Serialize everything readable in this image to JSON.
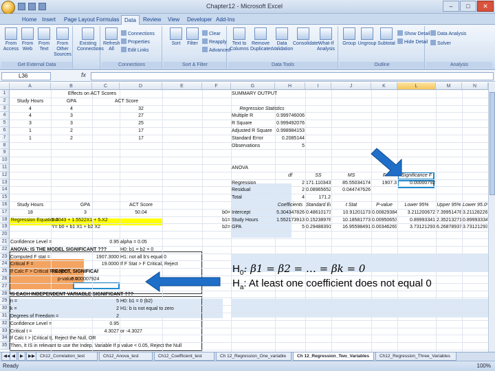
{
  "window": {
    "title": "Chapter12 - Microsoft Excel"
  },
  "tabs": [
    "Home",
    "Insert",
    "Page Layout",
    "Formulas",
    "Data",
    "Review",
    "View",
    "Developer",
    "Add-Ins"
  ],
  "active_tab": "Data",
  "ribbon": {
    "groups": [
      {
        "label": "Get External Data",
        "buttons": [
          "From Access",
          "From Web",
          "From Text",
          "From Other Sources"
        ]
      },
      {
        "label": "",
        "buttons": [
          "Existing Connections"
        ]
      },
      {
        "label": "Connections",
        "buttons": [
          "Refresh All"
        ],
        "small": [
          "Connections",
          "Properties",
          "Edit Links"
        ]
      },
      {
        "label": "Sort & Filter",
        "buttons": [
          "Sort",
          "Filter"
        ],
        "small": [
          "Clear",
          "Reapply",
          "Advanced"
        ]
      },
      {
        "label": "Data Tools",
        "buttons": [
          "Text to Columns",
          "Remove Duplicates",
          "Data Validation",
          "Consolidate",
          "What-If Analysis"
        ]
      },
      {
        "label": "Outline",
        "buttons": [
          "Group",
          "Ungroup",
          "Subtotal"
        ],
        "small": [
          "Show Detail",
          "Hide Detail"
        ]
      },
      {
        "label": "Analysis",
        "small": [
          "Data Analysis",
          "Solver"
        ]
      }
    ]
  },
  "formula_bar": {
    "name_box": "L36",
    "fx": "fx",
    "value": ""
  },
  "columns": [
    "A",
    "B",
    "C",
    "D",
    "E",
    "F",
    "G",
    "H",
    "I",
    "J",
    "K",
    "L",
    "M",
    "N"
  ],
  "rows": [
    "1",
    "2",
    "3",
    "4",
    "5",
    "6",
    "7",
    "8",
    "9",
    "10",
    "11",
    "12",
    "13",
    "14",
    "15",
    "16",
    "17",
    "18",
    "19",
    "20",
    "21",
    "22",
    "23",
    "24",
    "25",
    "26",
    "27",
    "28",
    "29",
    "30",
    "31",
    "32",
    "33",
    "34",
    "35"
  ],
  "left_table": {
    "title": "Effects on ACT Scores",
    "headers": [
      "Study Hours",
      "GPA",
      "ACT Score"
    ],
    "data": [
      [
        "4",
        "4",
        "32"
      ],
      [
        "4",
        "3",
        "27"
      ],
      [
        "3",
        "3",
        "25"
      ],
      [
        "1",
        "2",
        "17"
      ],
      [
        "1",
        "2",
        "17"
      ]
    ]
  },
  "prediction": {
    "headers": [
      "Study Hours",
      "GPA",
      "ACT Score"
    ],
    "values": [
      "18",
      "3",
      "50.04"
    ],
    "equation_label": "Regression Equation=",
    "equation": "5.3043 + 1.5522X1 + 5.X2",
    "general_form": "Y= b0 + b1 X1 + b2 X2"
  },
  "tests": {
    "confidence_label": "Confidence Level =",
    "confidence_value": "0.95",
    "alpha": "alpha = 0.05",
    "model_q": "ANOVA: IS THE MODEL SIGNIFICANT ???",
    "h0": "H0: b1 = b2 = 0",
    "h1": "H1: not all b's equal 0",
    "computed_f_label": "Computed F stat =",
    "computed_f": "1907.3000",
    "critical_f_label": "Critical F =",
    "critical_f": "19.0000",
    "rule1": "If F Stat > F Critical, Reject",
    "decision_label": "If Calc F > Critical F, Reject",
    "decision": "REJECT, SIGNIFICANT",
    "pvalue_label": "p-value =",
    "pvalue": "0.000007924",
    "var_q": "IS EACH INDEPENDENT VARIABLE SIGNIFICANT ???",
    "h0b": "H0: b1 = 0 (b2)",
    "h1b": "H1: b is not equal to zero",
    "n_label": "n =",
    "n": "5",
    "k_label": "k =",
    "k": "2",
    "df_label": "Degrees of Freedom =",
    "df": "2",
    "conf2_label": "Confidence Level =",
    "conf2": "0.95",
    "critical_t_label": "Critical t =",
    "critical_t": "4.3027",
    "critical_t2": "or -4.3027",
    "rule2": "If Calc t > |Critical t|, Reject the Null, OR",
    "rule3": "Then, It IS in relevant to use the Indep. Variable   If p value < 0.05, Reject the Null"
  },
  "summary": {
    "title": "SUMMARY OUTPUT",
    "reg_title": "Regression Statistics",
    "stats": [
      [
        "Multiple R",
        "0.999746006"
      ],
      [
        "R Square",
        "0.999492076"
      ],
      [
        "Adjusted R Square",
        "0.998984153"
      ],
      [
        "Standard Error",
        "0.2085144"
      ],
      [
        "Observations",
        "5"
      ]
    ],
    "anova_title": "ANOVA",
    "anova_headers": [
      "",
      "df",
      "SS",
      "MS",
      "F",
      "Significance F"
    ],
    "anova_rows": [
      [
        "Regression",
        "2",
        "171.1103435",
        "85.55034174",
        "1907.3",
        "0.00000792"
      ],
      [
        "Residual",
        "2",
        "0.089656522",
        "0.044747626",
        "",
        ""
      ],
      [
        "Total",
        "4",
        "171.2",
        "",
        "",
        ""
      ]
    ],
    "coef_headers": [
      "",
      "Coefficients",
      "Standard Error",
      "t Stat",
      "P-value",
      "Lower 95%",
      "Upper 95%",
      "Lower 95.0%"
    ],
    "coef_rows": [
      [
        "b0=",
        "Intercept",
        "5.304347826",
        "0.486101734",
        "10.91201173",
        "0.00829384",
        "3.211200672",
        "7.39951478",
        "3.211282267"
      ],
      [
        "b1=",
        "Study Hours",
        "1.552173913",
        "0.152389788",
        "10.18581773",
        "0.00950653",
        "0.89993341",
        "2.352132712",
        "0.899933341"
      ],
      [
        "b2=",
        "GPA",
        "5",
        "0.294883912",
        "16.95598491",
        "0.00346269",
        "3.73121293",
        "6.26878937",
        "3.73121293"
      ]
    ]
  },
  "overlay": {
    "line1_prefix": "H",
    "line1_sub": "0",
    "line1_rest": ": β1 = β2 = … = βk = 0",
    "line2_prefix": "H",
    "line2_sub": "a",
    "line2_rest": ": At least one coefficient does not equal 0"
  },
  "sheet_tabs": [
    "Ch12_Correlation_test",
    "Ch12_Anova_test",
    "Ch12_Coefficient_test",
    "Ch 12_Regression_One_variable",
    "Ch 12_Regression_Two_Variables",
    "Ch12_Regression_Three_Variables"
  ],
  "active_sheet": "Ch 12_Regression_Two_Variables",
  "status": {
    "ready": "Ready",
    "zoom": "100%"
  },
  "colors": {
    "accent": "#15428b",
    "highlight_yellow": "#ffff00",
    "highlight_blue": "#1e8bd0",
    "arrow_blue": "#1f6fc9"
  }
}
